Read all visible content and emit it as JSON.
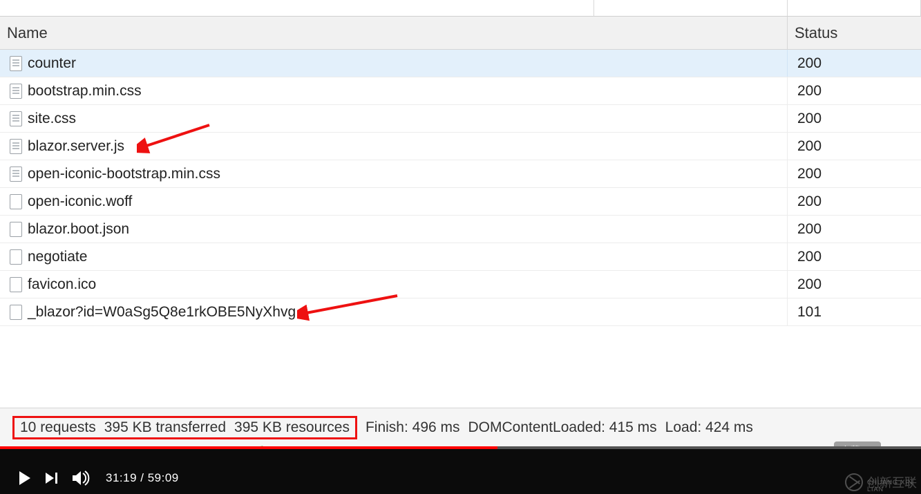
{
  "columns": {
    "name": "Name",
    "status": "Status"
  },
  "rows": [
    {
      "name": "counter",
      "status": "200",
      "icon": "filled",
      "selected": true
    },
    {
      "name": "bootstrap.min.css",
      "status": "200",
      "icon": "filled",
      "selected": false
    },
    {
      "name": "site.css",
      "status": "200",
      "icon": "filled",
      "selected": false
    },
    {
      "name": "blazor.server.js",
      "status": "200",
      "icon": "filled",
      "selected": false
    },
    {
      "name": "open-iconic-bootstrap.min.css",
      "status": "200",
      "icon": "filled",
      "selected": false
    },
    {
      "name": "open-iconic.woff",
      "status": "200",
      "icon": "empty",
      "selected": false
    },
    {
      "name": "blazor.boot.json",
      "status": "200",
      "icon": "empty",
      "selected": false
    },
    {
      "name": "negotiate",
      "status": "200",
      "icon": "empty",
      "selected": false
    },
    {
      "name": "favicon.ico",
      "status": "200",
      "icon": "empty",
      "selected": false
    },
    {
      "name": "_blazor?id=W0aSg5Q8e1rkOBE5NyXhvg",
      "status": "101",
      "icon": "empty",
      "selected": false
    }
  ],
  "summary": {
    "requests": "10 requests",
    "transferred": "395 KB transferred",
    "resources": "395 KB resources",
    "finish": "Finish: 496 ms",
    "dcl": "DOMContentLoaded: 415 ms",
    "load": "Load: 424 ms"
  },
  "player": {
    "time": "31:19 / 59:09",
    "subtitle_pill": "字幕 (c)"
  },
  "watermark": {
    "text": "创新互联",
    "sub": "CHUANG XIN LIAN"
  }
}
